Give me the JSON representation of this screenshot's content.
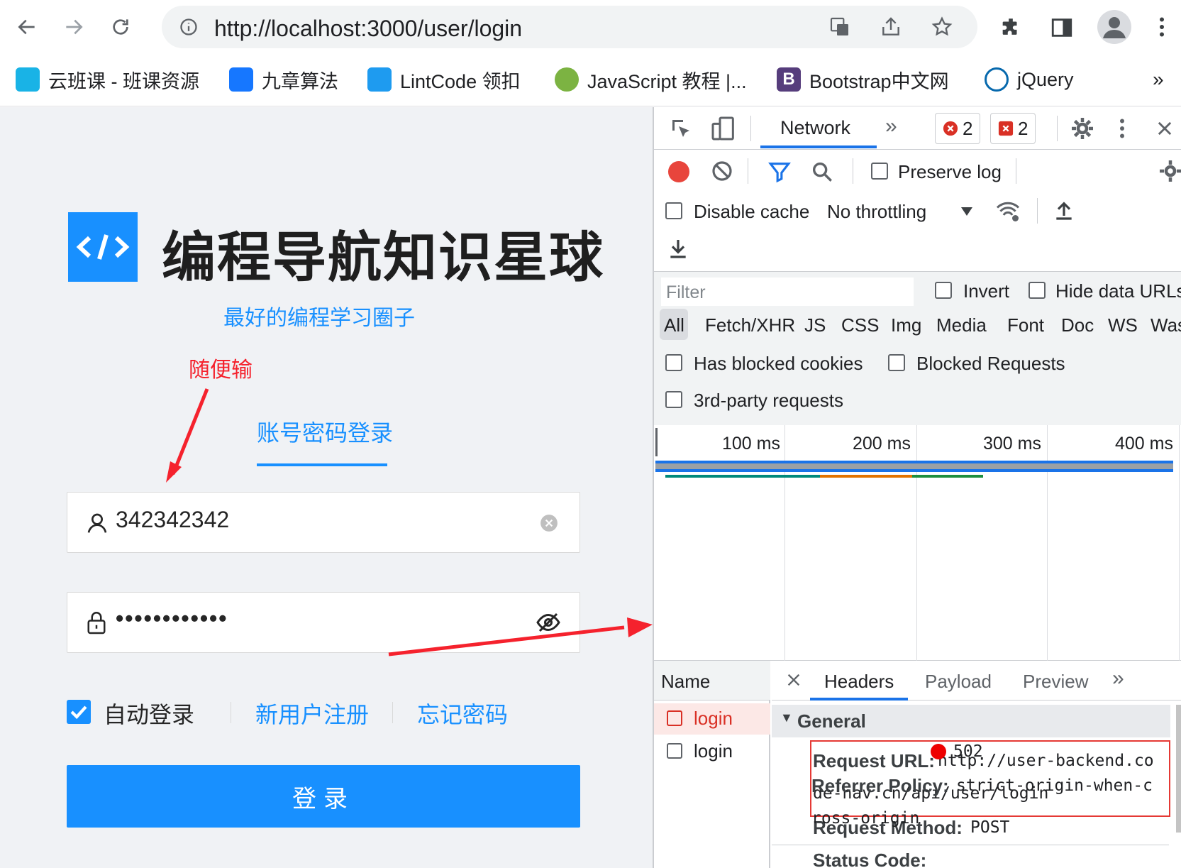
{
  "browser": {
    "url": "http://localhost:3000/user/login",
    "bookmarks": [
      {
        "label": "云班课 - 班课资源",
        "icon": "cloud-class-icon",
        "color": "#19b3e6"
      },
      {
        "label": "九章算法",
        "icon": "jiuzhang-icon",
        "color": "#1677ff"
      },
      {
        "label": "LintCode 领扣",
        "icon": "lintcode-icon",
        "color": "#1e9bf0"
      },
      {
        "label": "JavaScript 教程 |...",
        "icon": "javascript-icon",
        "color": "#7cb342"
      },
      {
        "label": "Bootstrap中文网",
        "icon": "bootstrap-icon",
        "color": "#563d7c"
      },
      {
        "label": "jQuery",
        "icon": "jquery-icon",
        "color": "#0769ad"
      }
    ],
    "more_bookmarks": "»"
  },
  "login_page": {
    "brand_title": "编程导航知识星球",
    "slogan": "最好的编程学习圈子",
    "annotation_label": "随便输",
    "tab_label": "账号密码登录",
    "username_value": "342342342",
    "password_value": "••••••••••••",
    "remember_label": "自动登录",
    "register_link": "新用户注册",
    "forgot_link": "忘记密码",
    "submit_label": "登录",
    "accent_color": "#1890ff"
  },
  "devtools": {
    "active_panel": "Network",
    "more_panels": "»",
    "errors_count": "2",
    "issues_count": "2",
    "preserve_log": "Preserve log",
    "disable_cache": "Disable cache",
    "throttling": "No throttling",
    "filter_placeholder": "Filter",
    "invert": "Invert",
    "hide_data_urls": "Hide data URLs",
    "type_filters": [
      "All",
      "Fetch/XHR",
      "JS",
      "CSS",
      "Img",
      "Media",
      "Font",
      "Doc",
      "WS",
      "Was"
    ],
    "has_blocked_cookies": "Has blocked cookies",
    "blocked_requests": "Blocked Requests",
    "third_party": "3rd-party requests",
    "timeline_ticks": [
      "100 ms",
      "200 ms",
      "300 ms",
      "400 ms"
    ],
    "name_header": "Name",
    "requests": [
      {
        "name": "login",
        "failed": true
      },
      {
        "name": "login",
        "failed": false
      }
    ],
    "detail_tabs": [
      "Headers",
      "Payload",
      "Preview"
    ],
    "detail_more": "»",
    "general_label": "General",
    "request_url_label": "Request URL:",
    "request_url_line1": "http://user-backend.co",
    "request_url_line2": "de-nav.cn/api/user/login",
    "request_method_label": "Request Method:",
    "request_method_value": "POST",
    "status_code_label": "Status Code:",
    "status_code_value": "502",
    "referrer_policy_label": "Referrer Policy:",
    "referrer_policy_line1": "strict-origin-when-c",
    "referrer_policy_line2": "ross-origin"
  }
}
